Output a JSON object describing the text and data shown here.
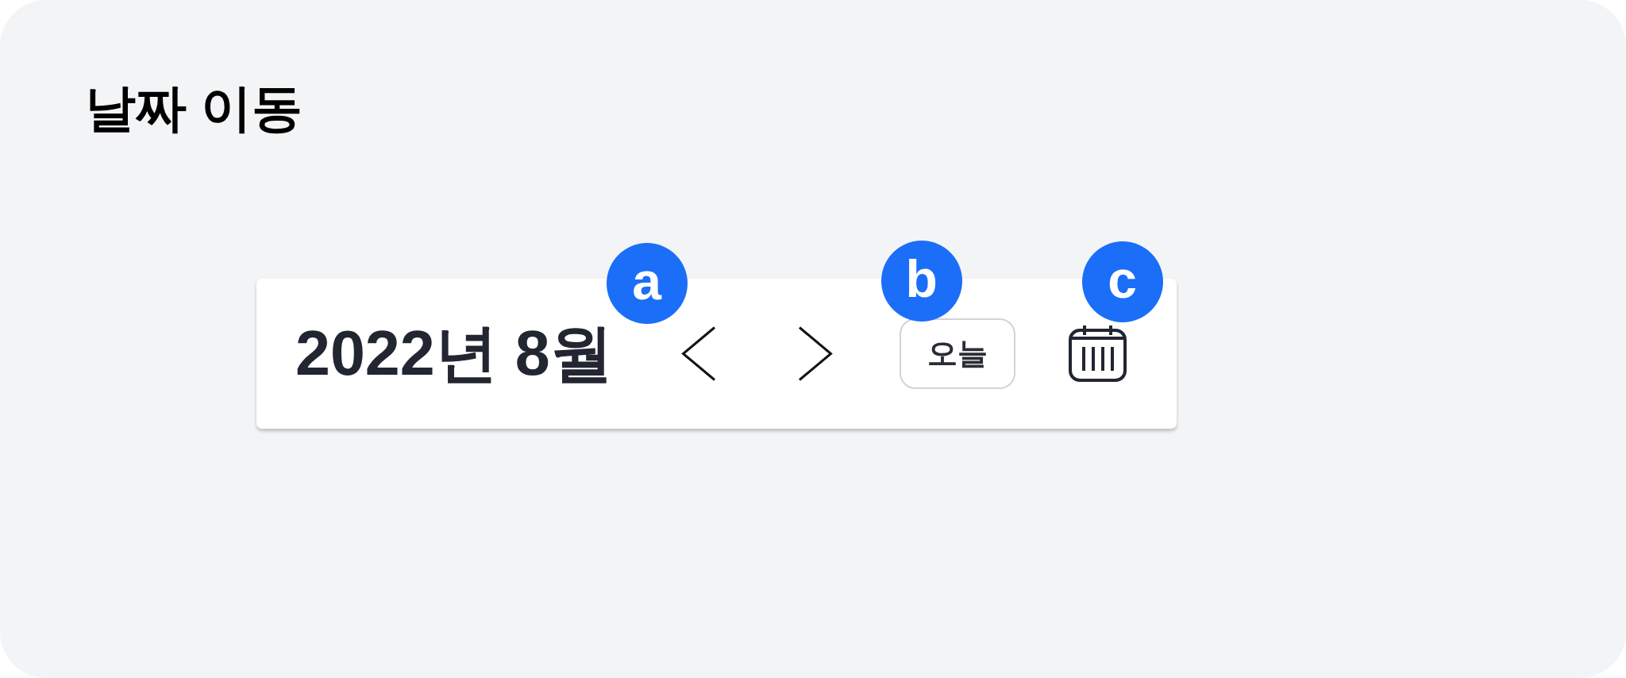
{
  "title": "날짜 이동",
  "date_navigator": {
    "month_label": {
      "text": "2022년 8월",
      "marker": "a"
    },
    "today_button": {
      "label": "오늘",
      "marker": "b"
    },
    "calendar_button": {
      "marker": "c"
    }
  }
}
